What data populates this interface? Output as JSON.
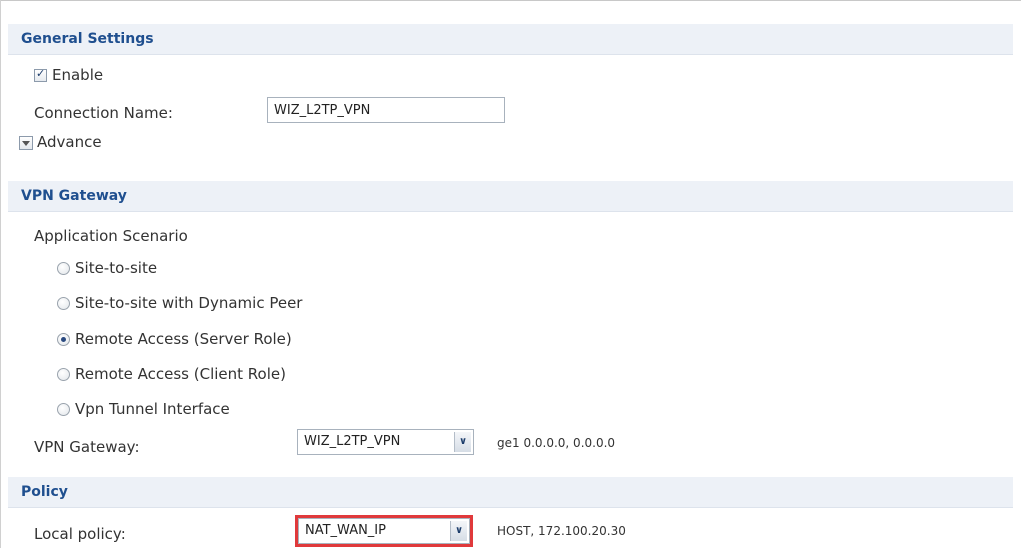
{
  "general_settings": {
    "title": "General Settings",
    "enable_label": "Enable",
    "enable_checked": true,
    "connection_name_label": "Connection Name:",
    "connection_name_value": "WIZ_L2TP_VPN",
    "advance_label": "Advance"
  },
  "vpn_gateway": {
    "title": "VPN Gateway",
    "scenario_label": "Application Scenario",
    "scenarios": [
      {
        "label": "Site-to-site",
        "selected": false
      },
      {
        "label": "Site-to-site with Dynamic Peer",
        "selected": false
      },
      {
        "label": "Remote Access (Server Role)",
        "selected": true
      },
      {
        "label": "Remote Access (Client Role)",
        "selected": false
      },
      {
        "label": "Vpn Tunnel Interface",
        "selected": false
      }
    ],
    "gateway_label": "VPN Gateway:",
    "gateway_value": "WIZ_L2TP_VPN",
    "gateway_info": "ge1  0.0.0.0, 0.0.0.0"
  },
  "policy": {
    "title": "Policy",
    "local_policy_label": "Local policy:",
    "local_policy_value": "NAT_WAN_IP",
    "local_policy_info": "HOST, 172.100.20.30"
  },
  "colors": {
    "header_bg": "#edf1f7",
    "header_text": "#1f4f8f",
    "highlight": "#e0393b"
  }
}
